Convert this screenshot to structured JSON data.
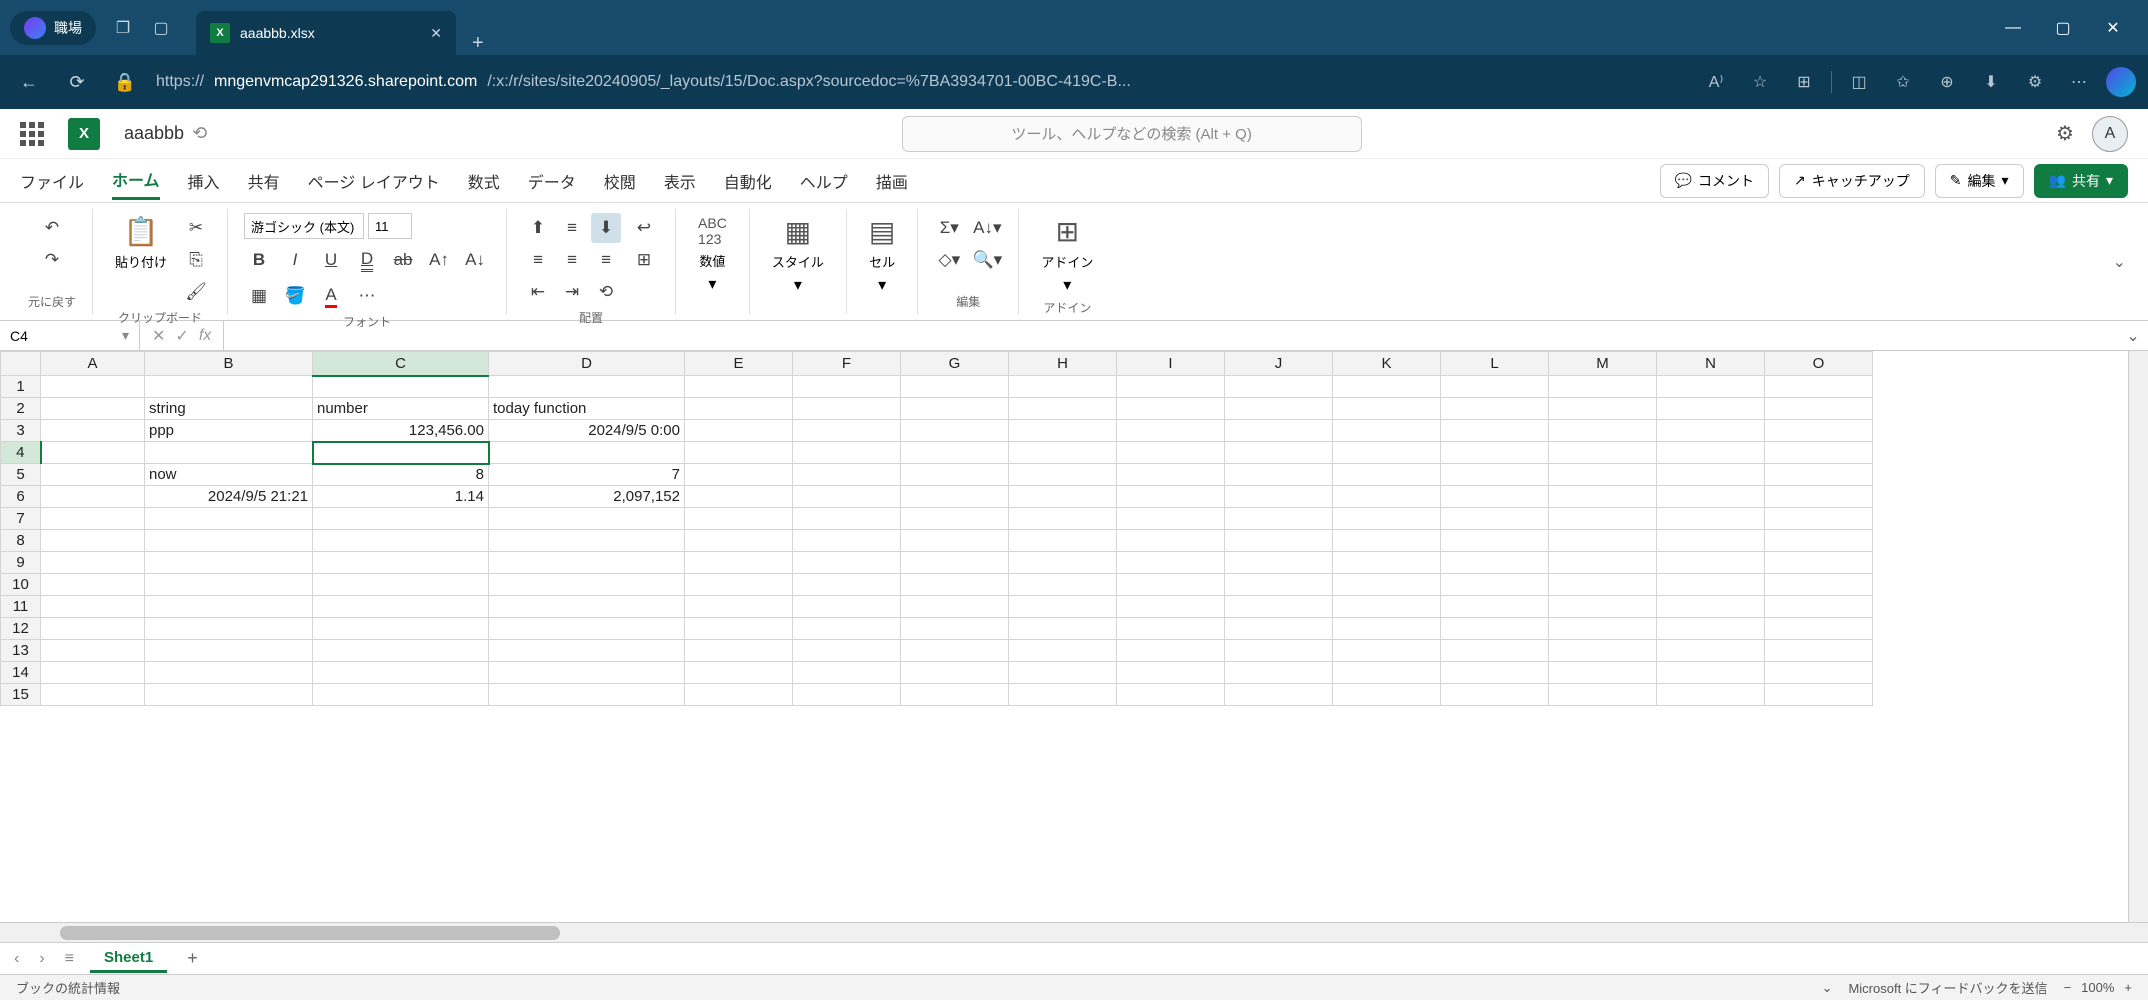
{
  "browser": {
    "workspace_label": "職場",
    "tab_title": "aaabbb.xlsx",
    "url_prefix": "https://",
    "url_host": "mngenvmcap291326.sharepoint.com",
    "url_path": "/:x:/r/sites/site20240905/_layouts/15/Doc.aspx?sourcedoc=%7BA3934701-00BC-419C-B..."
  },
  "title_bar": {
    "doc_name": "aaabbb",
    "search_placeholder": "ツール、ヘルプなどの検索 (Alt + Q)",
    "avatar_letter": "A"
  },
  "ribbon_tabs": [
    "ファイル",
    "ホーム",
    "挿入",
    "共有",
    "ページ レイアウト",
    "数式",
    "データ",
    "校閲",
    "表示",
    "自動化",
    "ヘルプ",
    "描画"
  ],
  "ribbon_active_tab": "ホーム",
  "ribbon_actions": {
    "comment": "コメント",
    "catchup": "キャッチアップ",
    "edit": "編集",
    "share": "共有"
  },
  "ribbon_groups": {
    "undo": "元に戻す",
    "clipboard": "クリップボード",
    "clipboard_paste": "貼り付け",
    "font": "フォント",
    "font_name": "游ゴシック (本文)",
    "font_size": "11",
    "alignment": "配置",
    "number": "数値",
    "styles": "スタイル",
    "cells": "セル",
    "editing": "編集",
    "addins": "アドイン"
  },
  "name_box": "C4",
  "columns": [
    "A",
    "B",
    "C",
    "D",
    "E",
    "F",
    "G",
    "H",
    "I",
    "J",
    "K",
    "L",
    "M",
    "N",
    "O"
  ],
  "row_count": 15,
  "selected": {
    "row": 4,
    "col": "C"
  },
  "chart_data": {
    "type": "table",
    "cells": {
      "B2": {
        "v": "string",
        "align": "left"
      },
      "C2": {
        "v": "number",
        "align": "left"
      },
      "D2": {
        "v": "today function",
        "align": "left"
      },
      "B3": {
        "v": "ppp",
        "align": "left"
      },
      "C3": {
        "v": "123,456.00",
        "align": "right"
      },
      "D3": {
        "v": "2024/9/5 0:00",
        "align": "right"
      },
      "B5": {
        "v": "now",
        "align": "left"
      },
      "C5": {
        "v": "8",
        "align": "right"
      },
      "D5": {
        "v": "7",
        "align": "right"
      },
      "B6": {
        "v": "2024/9/5 21:21",
        "align": "right"
      },
      "C6": {
        "v": "1.14",
        "align": "right"
      },
      "D6": {
        "v": "2,097,152",
        "align": "right"
      }
    }
  },
  "sheet_tabs": {
    "active": "Sheet1"
  },
  "status_bar": {
    "left": "ブックの統計情報",
    "feedback": "Microsoft にフィードバックを送信",
    "zoom": "100%"
  }
}
